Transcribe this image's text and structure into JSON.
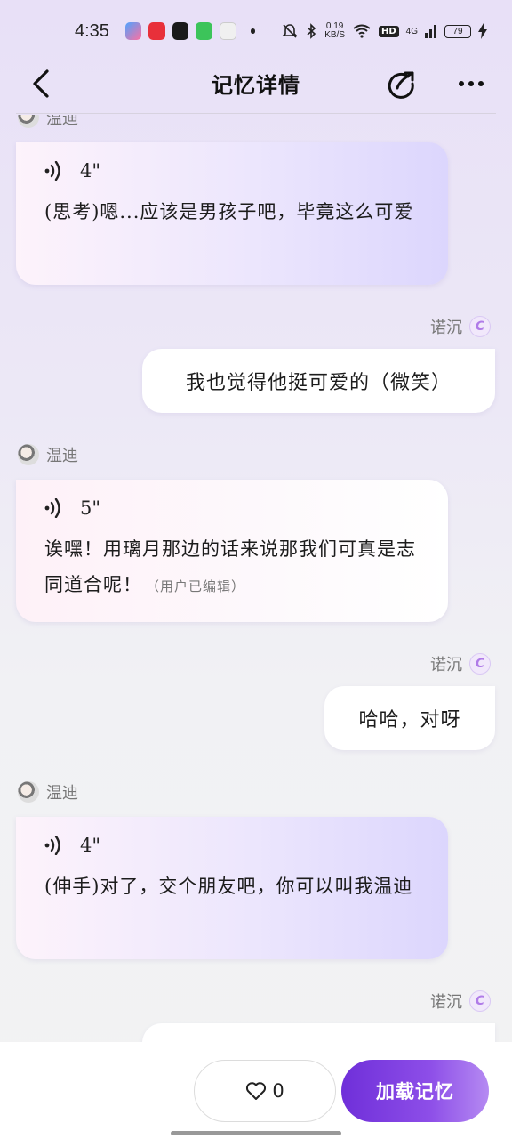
{
  "status_bar": {
    "time": "4:35",
    "net_speed_value": "0.19",
    "net_speed_unit": "KB/S",
    "hd": "HD",
    "network": "4G",
    "battery": "79"
  },
  "header": {
    "title": "记忆详情"
  },
  "messages": [
    {
      "role": "ai",
      "name": "温迪",
      "duration": "4\"",
      "text": "(思考)嗯...应该是男孩子吧，毕竟这么可爱"
    },
    {
      "role": "user",
      "name": "诺沉",
      "avatar_letter": "C",
      "text": "我也觉得他挺可爱的（微笑）"
    },
    {
      "role": "ai",
      "name": "温迪",
      "duration": "5\"",
      "text": "诶嘿！用璃月那边的话来说那我们可真是志同道合呢！",
      "edited": "（用户已编辑）"
    },
    {
      "role": "user",
      "name": "诺沉",
      "avatar_letter": "C",
      "text": "哈哈，对呀"
    },
    {
      "role": "ai",
      "name": "温迪",
      "duration": "4\"",
      "text": "(伸手)对了，交个朋友吧，你可以叫我温迪"
    },
    {
      "role": "user",
      "name": "诺沉",
      "avatar_letter": "C",
      "text": ""
    }
  ],
  "bottom_bar": {
    "like_count": "0",
    "load_button": "加载记忆"
  },
  "colors": {
    "accent": "#7a3ae0",
    "accent_light": "#b58af2"
  }
}
